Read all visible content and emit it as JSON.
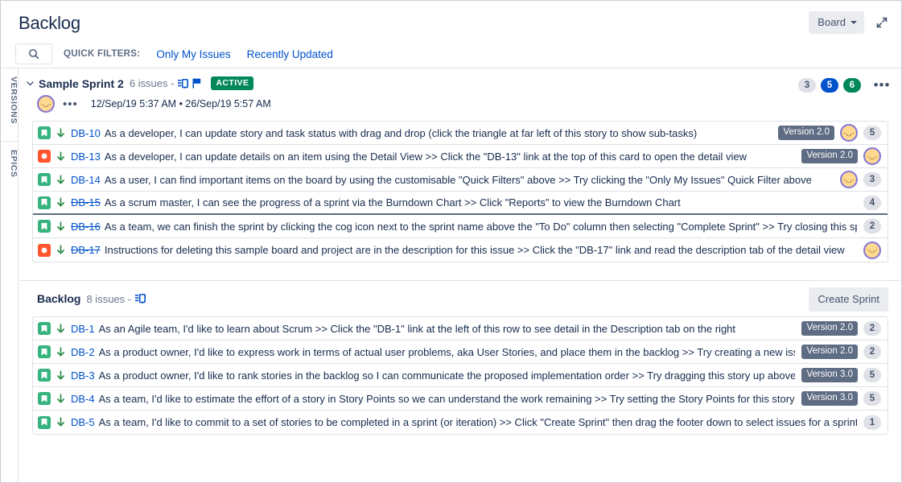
{
  "header": {
    "title": "Backlog",
    "board_button": "Board",
    "expand_icon": "expand-icon",
    "search_icon": "search-icon",
    "search_placeholder": "",
    "quick_filters_label": "QUICK FILTERS:",
    "quick_filters": [
      "Only My Issues",
      "Recently Updated"
    ]
  },
  "rail": {
    "tabs": [
      "VERSIONS",
      "EPICS"
    ]
  },
  "sprint": {
    "name": "Sample Sprint 2",
    "issue_count": "6 issues -",
    "estimate_icon": "estimate-icon",
    "flag_icon": "flag-icon",
    "status_badge": "ACTIVE",
    "counts": [
      {
        "value": "3",
        "color": "#dfe1e6",
        "style": "grey"
      },
      {
        "value": "5",
        "color": "#0052cc",
        "style": "blue"
      },
      {
        "value": "6",
        "color": "#00875a",
        "style": "green"
      }
    ],
    "more_menu": "•••",
    "avatar_emoji": "·◡·",
    "meta_dots": "•••",
    "dates": "12/Sep/19 5:37 AM • 26/Sep/19 5:57 AM",
    "issues": [
      {
        "type": "story",
        "priority": "low",
        "key": "DB-10",
        "done": false,
        "summary": "As a developer, I can update story and task status with drag and drop (click the triangle at far left of this story to show sub-tasks)",
        "version": "Version 2.0",
        "avatar": true,
        "points": "5",
        "dropline": false
      },
      {
        "type": "bug",
        "priority": "low",
        "key": "DB-13",
        "done": false,
        "summary": "As a developer, I can update details on an item using the Detail View >> Click the \"DB-13\" link at the top of this card to open the detail view",
        "version": "Version 2.0",
        "avatar": true,
        "points": "",
        "dropline": false
      },
      {
        "type": "story",
        "priority": "low",
        "key": "DB-14",
        "done": false,
        "summary": "As a user, I can find important items on the board by using the customisable \"Quick Filters\" above >> Try clicking the \"Only My Issues\" Quick Filter above",
        "version": "",
        "avatar": true,
        "points": "3",
        "dropline": false
      },
      {
        "type": "story",
        "priority": "low",
        "key": "DB-15",
        "done": true,
        "summary": "As a scrum master, I can see the progress of a sprint via the Burndown Chart >> Click \"Reports\" to view the Burndown Chart",
        "version": "",
        "avatar": false,
        "points": "4",
        "dropline": true
      },
      {
        "type": "story",
        "priority": "low",
        "key": "DB-16",
        "done": true,
        "summary": "As a team, we can finish the sprint by clicking the cog icon next to the sprint name above the \"To Do\" column then selecting \"Complete Sprint\" >> Try closing this sprint",
        "version": "",
        "avatar": false,
        "points": "2",
        "dropline": false
      },
      {
        "type": "bug",
        "priority": "low",
        "key": "DB-17",
        "done": true,
        "summary": "Instructions for deleting this sample board and project are in the description for this issue >> Click the \"DB-17\" link and read the description tab of the detail view",
        "version": "",
        "avatar": true,
        "points": "",
        "dropline": false
      }
    ]
  },
  "backlog": {
    "title": "Backlog",
    "issue_count": "8 issues -",
    "estimate_icon": "estimate-icon",
    "create_sprint_button": "Create Sprint",
    "issues": [
      {
        "type": "story",
        "priority": "low",
        "key": "DB-1",
        "done": false,
        "summary": "As an Agile team, I'd like to learn about Scrum >> Click the \"DB-1\" link at the left of this row to see detail in the Description tab on the right",
        "version": "Version 2.0",
        "avatar": false,
        "points": "2"
      },
      {
        "type": "story",
        "priority": "low",
        "key": "DB-2",
        "done": false,
        "summary": "As a product owner, I'd like to express work in terms of actual user problems, aka User Stories, and place them in the backlog >> Try creating a new issue",
        "version": "Version 2.0",
        "avatar": false,
        "points": "2"
      },
      {
        "type": "story",
        "priority": "low",
        "key": "DB-3",
        "done": false,
        "summary": "As a product owner, I'd like to rank stories in the backlog so I can communicate the proposed implementation order >> Try dragging this story up above the others",
        "version": "Version 3.0",
        "avatar": false,
        "points": "5"
      },
      {
        "type": "story",
        "priority": "low",
        "key": "DB-4",
        "done": false,
        "summary": "As a team, I'd like to estimate the effort of a story in Story Points so we can understand the work remaining >> Try setting the Story Points for this story",
        "version": "Version 3.0",
        "avatar": false,
        "points": "5"
      },
      {
        "type": "story",
        "priority": "low",
        "key": "DB-5",
        "done": false,
        "summary": "As a team, I'd like to commit to a set of stories to be completed in a sprint (or iteration) >> Click \"Create Sprint\" then drag the footer down to select issues for a sprint",
        "version": "",
        "avatar": false,
        "points": "1"
      }
    ]
  },
  "colors": {
    "link": "#0052cc",
    "story": "#36b37e",
    "bug": "#ff5630",
    "active": "#00875a",
    "version": "#5e6c84",
    "text": "#172b4d",
    "subtle": "#6b778c"
  }
}
